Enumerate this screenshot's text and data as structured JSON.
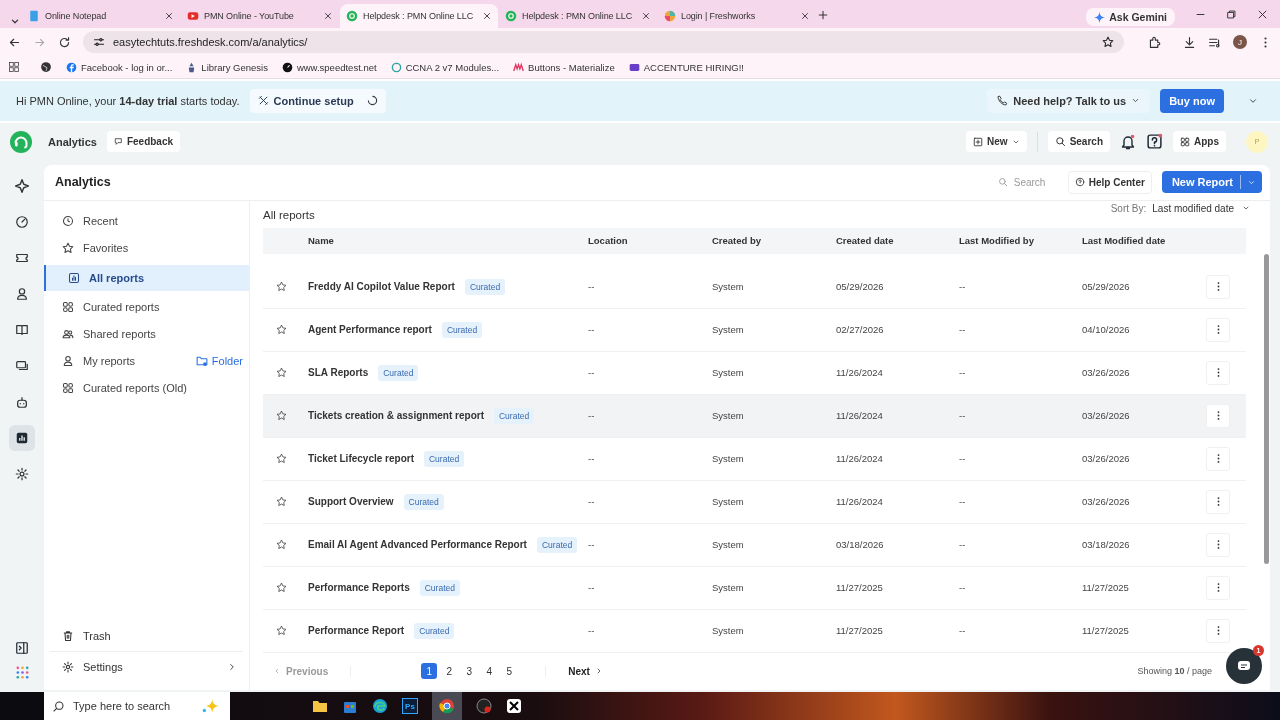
{
  "browser": {
    "tabs": [
      {
        "title": "Online Notepad",
        "selected": false
      },
      {
        "title": "PMN Online - YouTube",
        "selected": false
      },
      {
        "title": "Helpdesk : PMN Online LLC",
        "selected": true
      },
      {
        "title": "Helpdesk : PMN Online LLC",
        "selected": false
      },
      {
        "title": "Login | Freshworks",
        "selected": false
      }
    ],
    "ask_gemini": "Ask Gemini",
    "url": "easytechtuts.freshdesk.com/a/analytics/",
    "avatar": "J",
    "bookmarks": [
      "Facebook - log in or...",
      "Library Genesis",
      "www.speedtest.net",
      "CCNA 2 v7 Modules...",
      "Buttons - Materialize",
      "ACCENTURE HIRING!!"
    ]
  },
  "banner": {
    "message": "Hi PMN Online, your **14-day trial** starts today.",
    "continue_setup": "Continue setup",
    "need_help": "Need help? Talk to us",
    "buy_now": "Buy now"
  },
  "header": {
    "title": "Analytics",
    "feedback": "Feedback",
    "new": "New",
    "search": "Search",
    "apps": "Apps",
    "avatar": "P"
  },
  "rail": [
    {
      "selected": false
    },
    {
      "selected": false
    },
    {
      "selected": false
    },
    {
      "selected": false
    },
    {
      "selected": false
    },
    {
      "selected": false
    },
    {
      "selected": false
    },
    {
      "selected": true
    },
    {
      "selected": false
    }
  ],
  "page": {
    "title": "Analytics",
    "search_placeholder": "Search",
    "help_center": "Help Center",
    "new_report": "New Report"
  },
  "nav": {
    "items": [
      {
        "label": "Recent",
        "selected": false
      },
      {
        "label": "Favorites",
        "selected": false
      },
      {
        "label": "All reports",
        "selected": true
      },
      {
        "label": "Curated reports",
        "selected": false
      },
      {
        "label": "Shared reports",
        "selected": false
      },
      {
        "label": "My reports",
        "selected": false
      },
      {
        "label": "Curated reports (Old)",
        "selected": false
      }
    ],
    "folder": "Folder",
    "trash": "Trash",
    "settings": "Settings"
  },
  "reports": {
    "title": "All reports",
    "sort_label": "Sort By:",
    "sort_value": "Last modified date",
    "columns": [
      "Name",
      "Location",
      "Created by",
      "Created date",
      "Last Modified by",
      "Last Modified date"
    ],
    "rows": [
      {
        "name": "Freddy AI Copilot Value Report",
        "tag": "Curated",
        "location": "--",
        "created_by": "System",
        "created_date": "05/29/2026",
        "modified_by": "--",
        "modified_date": "05/29/2026",
        "favorite": false,
        "highlighted": false
      },
      {
        "name": "Agent Performance report",
        "tag": "Curated",
        "location": "--",
        "created_by": "System",
        "created_date": "02/27/2026",
        "modified_by": "--",
        "modified_date": "04/10/2026",
        "favorite": false,
        "highlighted": false
      },
      {
        "name": "SLA Reports",
        "tag": "Curated",
        "location": "--",
        "created_by": "System",
        "created_date": "11/26/2024",
        "modified_by": "--",
        "modified_date": "03/26/2026",
        "favorite": false,
        "highlighted": false
      },
      {
        "name": "Tickets creation & assignment report",
        "tag": "Curated",
        "location": "--",
        "created_by": "System",
        "created_date": "11/26/2024",
        "modified_by": "--",
        "modified_date": "03/26/2026",
        "favorite": false,
        "highlighted": true
      },
      {
        "name": "Ticket Lifecycle report",
        "tag": "Curated",
        "location": "--",
        "created_by": "System",
        "created_date": "11/26/2024",
        "modified_by": "--",
        "modified_date": "03/26/2026",
        "favorite": false,
        "highlighted": false
      },
      {
        "name": "Support Overview",
        "tag": "Curated",
        "location": "--",
        "created_by": "System",
        "created_date": "11/26/2024",
        "modified_by": "--",
        "modified_date": "03/26/2026",
        "favorite": false,
        "highlighted": false
      },
      {
        "name": "Email AI Agent Advanced Performance Report",
        "tag": "Curated",
        "location": "--",
        "created_by": "System",
        "created_date": "03/18/2026",
        "modified_by": "--",
        "modified_date": "03/18/2026",
        "favorite": false,
        "highlighted": false
      },
      {
        "name": "Performance Reports",
        "tag": "Curated",
        "location": "--",
        "created_by": "System",
        "created_date": "11/27/2025",
        "modified_by": "--",
        "modified_date": "11/27/2025",
        "favorite": false,
        "highlighted": false
      },
      {
        "name": "Performance Report",
        "tag": "Curated",
        "location": "--",
        "created_by": "System",
        "created_date": "11/27/2025",
        "modified_by": "--",
        "modified_date": "11/27/2025",
        "favorite": false,
        "highlighted": false
      }
    ],
    "previous": "Previous",
    "pages": [
      {
        "label": "1",
        "selected": true
      },
      {
        "label": "2",
        "selected": false
      },
      {
        "label": "3",
        "selected": false
      },
      {
        "label": "4",
        "selected": false
      },
      {
        "label": "5",
        "selected": false
      }
    ],
    "next": "Next",
    "showing": "Showing **10** / page"
  },
  "chat_badge": "1",
  "taskbar": {
    "search_placeholder": "Type here to search",
    "ps_label": "Ps"
  }
}
